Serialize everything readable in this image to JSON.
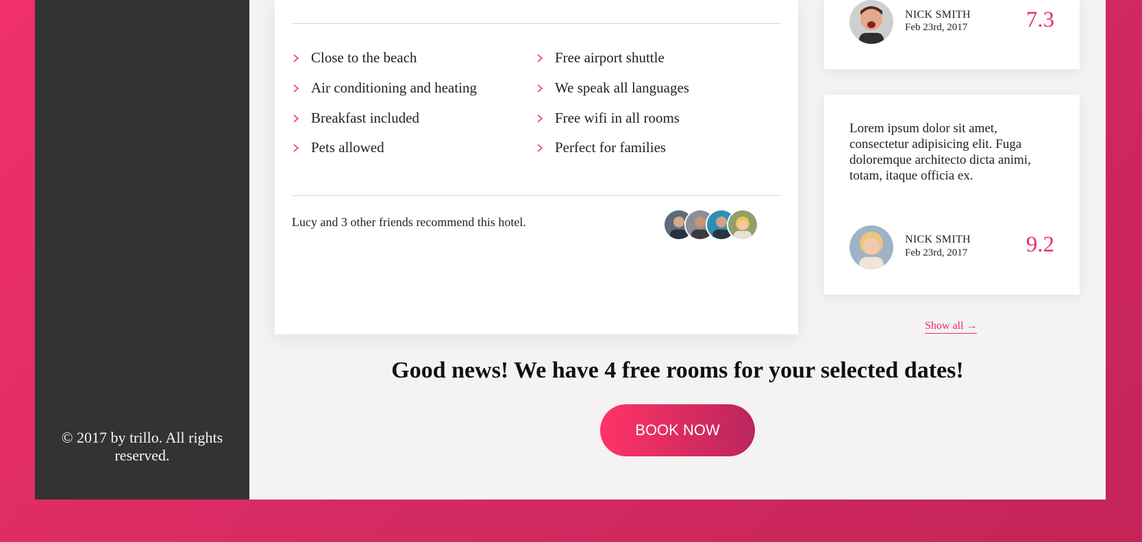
{
  "sidebar": {
    "copyright": "© 2017 by trillo. All rights reserved."
  },
  "hotel": {
    "features": [
      "Close to the beach",
      "Free airport shuttle",
      "Air conditioning and heating",
      "We speak all languages",
      "Breakfast included",
      "Free wifi in all rooms",
      "Pets allowed",
      "Perfect for families"
    ],
    "recommend_text": "Lucy and 3 other friends recommend this hotel."
  },
  "reviews": [
    {
      "name": "NICK SMITH",
      "date": "Feb 23rd, 2017",
      "rating": "7.3",
      "text": ""
    },
    {
      "name": "NICK SMITH",
      "date": "Feb 23rd, 2017",
      "rating": "9.2",
      "text": "Lorem ipsum dolor sit amet, consectetur adipisicing elit. Fuga doloremque architecto dicta animi, totam, itaque officia ex."
    }
  ],
  "show_all": "Show all →",
  "cta": {
    "heading": "Good news! We have 4 free rooms for your selected dates!",
    "button": "BOOK NOW"
  },
  "colors": {
    "accent": "#eb2f64",
    "sidebar": "#333333",
    "content_bg": "#f4f2f2",
    "frame_bg": "#e62c64"
  },
  "icons": {
    "feature_bullet": "chevron-right-icon"
  }
}
